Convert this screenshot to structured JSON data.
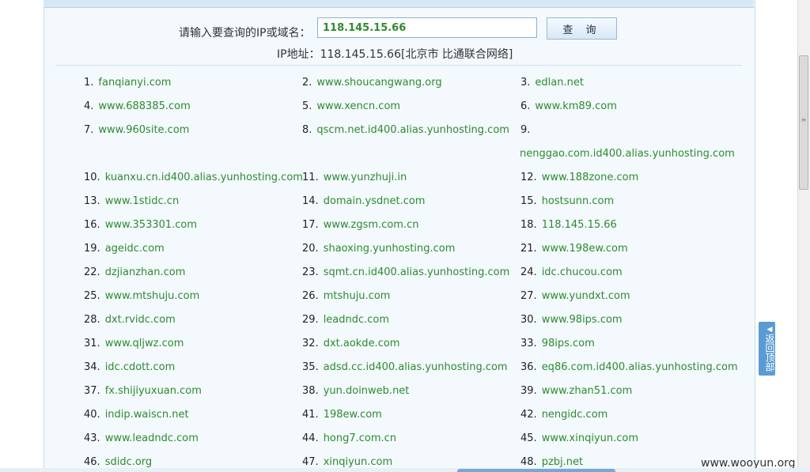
{
  "query": {
    "label": "请输入要查询的IP或域名：",
    "input_value": "118.145.15.66",
    "button_label": "查 询"
  },
  "result": {
    "text": "IP地址：118.145.15.66[北京市 比通联合网络]"
  },
  "domains": [
    {
      "num": "1.",
      "name": "fanqianyi.com"
    },
    {
      "num": "2.",
      "name": "www.shoucangwang.org"
    },
    {
      "num": "3.",
      "name": "edlan.net"
    },
    {
      "num": "4.",
      "name": "www.688385.com"
    },
    {
      "num": "5.",
      "name": "www.xencn.com"
    },
    {
      "num": "6.",
      "name": "www.km89.com"
    },
    {
      "num": "7.",
      "name": "www.960site.com"
    },
    {
      "num": "8.",
      "name": "qscm.net.id400.alias.yunhosting.com"
    },
    {
      "num": "9.",
      "name": "nenggao.com.id400.alias.yunhosting.com"
    },
    {
      "num": "10.",
      "name": "kuanxu.cn.id400.alias.yunhosting.com"
    },
    {
      "num": "11.",
      "name": "www.yunzhuji.in"
    },
    {
      "num": "12.",
      "name": "www.188zone.com"
    },
    {
      "num": "13.",
      "name": "www.1stidc.cn"
    },
    {
      "num": "14.",
      "name": "domain.ysdnet.com"
    },
    {
      "num": "15.",
      "name": "hostsunn.com"
    },
    {
      "num": "16.",
      "name": "www.353301.com"
    },
    {
      "num": "17.",
      "name": "www.zgsm.com.cn"
    },
    {
      "num": "18.",
      "name": "118.145.15.66"
    },
    {
      "num": "19.",
      "name": "ageidc.com"
    },
    {
      "num": "20.",
      "name": "shaoxing.yunhosting.com"
    },
    {
      "num": "21.",
      "name": "www.198ew.com"
    },
    {
      "num": "22.",
      "name": "dzjianzhan.com"
    },
    {
      "num": "23.",
      "name": "sqmt.cn.id400.alias.yunhosting.com"
    },
    {
      "num": "24.",
      "name": "idc.chucou.com"
    },
    {
      "num": "25.",
      "name": "www.mtshuju.com"
    },
    {
      "num": "26.",
      "name": "mtshuju.com"
    },
    {
      "num": "27.",
      "name": "www.yundxt.com"
    },
    {
      "num": "28.",
      "name": "dxt.rvidc.com"
    },
    {
      "num": "29.",
      "name": "leadndc.com"
    },
    {
      "num": "30.",
      "name": "www.98ips.com"
    },
    {
      "num": "31.",
      "name": "www.qljwz.com"
    },
    {
      "num": "32.",
      "name": "dxt.aokde.com"
    },
    {
      "num": "33.",
      "name": "98ips.com"
    },
    {
      "num": "34.",
      "name": "idc.cdott.com"
    },
    {
      "num": "35.",
      "name": "adsd.cc.id400.alias.yunhosting.com"
    },
    {
      "num": "36.",
      "name": "eq86.com.id400.alias.yunhosting.com"
    },
    {
      "num": "37.",
      "name": "fx.shijiyuxuan.com"
    },
    {
      "num": "38.",
      "name": "yun.doinweb.net"
    },
    {
      "num": "39.",
      "name": "www.zhan51.com"
    },
    {
      "num": "40.",
      "name": "indip.waiscn.net"
    },
    {
      "num": "41.",
      "name": "198ew.com"
    },
    {
      "num": "42.",
      "name": "nengidc.com"
    },
    {
      "num": "43.",
      "name": "www.leadndc.com"
    },
    {
      "num": "44.",
      "name": "hong7.com.cn"
    },
    {
      "num": "45.",
      "name": "www.xinqiyun.com"
    },
    {
      "num": "46.",
      "name": "sdidc.org"
    },
    {
      "num": "47.",
      "name": "xinqiyun.com"
    },
    {
      "num": "48.",
      "name": "pzbj.net"
    }
  ],
  "back_to_top": "返回顶部",
  "watermark": "www.wooyun.org",
  "colors": {
    "link": "#2e8b2e",
    "frame_bg": "#f3f9fd",
    "back_to_top_bg": "#5b9bd5"
  }
}
